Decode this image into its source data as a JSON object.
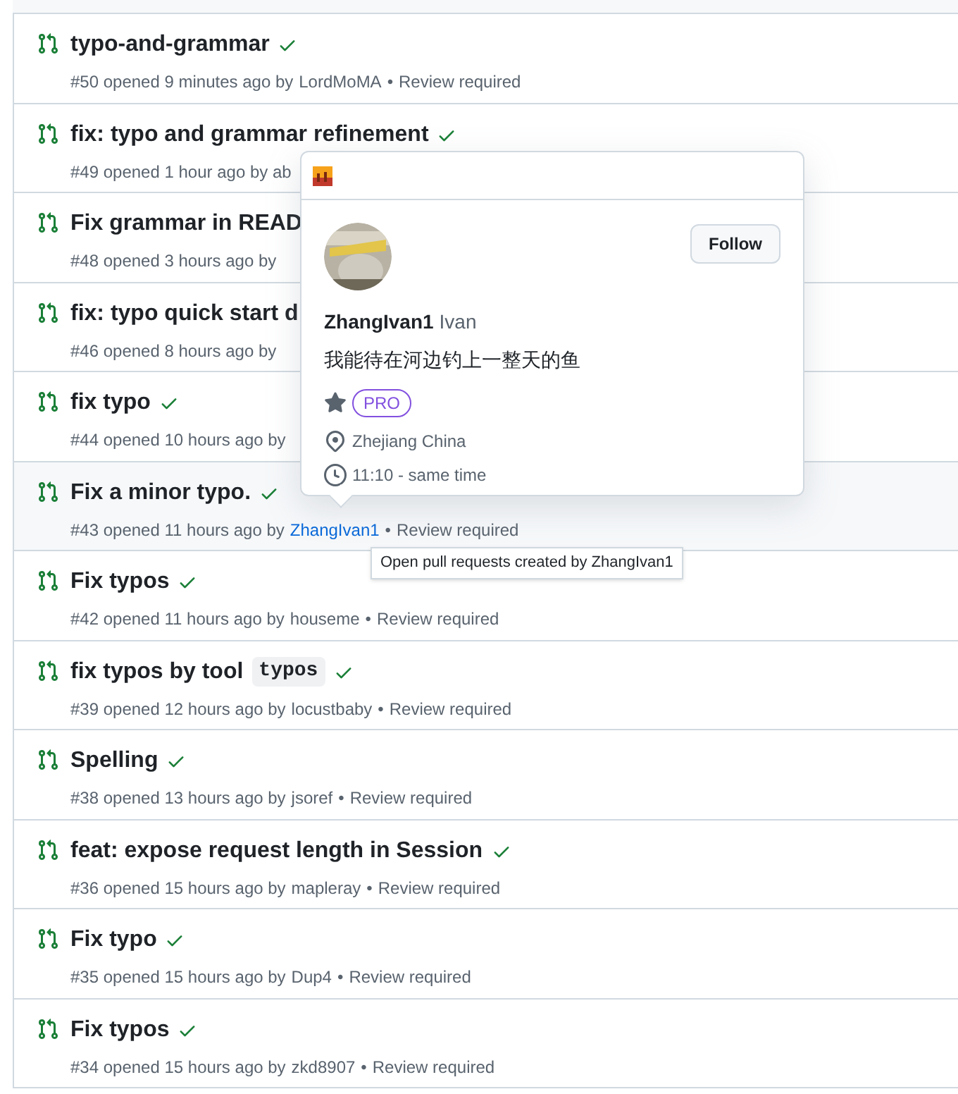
{
  "pull_requests": [
    {
      "title": "typo-and-grammar",
      "checked": true,
      "meta": "#50 opened 9 minutes ago by",
      "author": "LordMoMA",
      "separator": "•",
      "status": "Review required",
      "hovered": false
    },
    {
      "title": "fix: typo and grammar refinement",
      "checked": true,
      "meta": "#49 opened 1 hour ago by ab",
      "hovered": false
    },
    {
      "title": "Fix grammar in READ",
      "meta": "#48 opened 3 hours ago by"
    },
    {
      "title": "fix: typo quick start d",
      "meta": "#46 opened 8 hours ago by"
    },
    {
      "title": "fix typo",
      "checked": true,
      "meta": "#44 opened 10 hours ago by",
      "hovered": false
    },
    {
      "title": "Fix a minor typo.",
      "checked": true,
      "meta": "#43 opened 11 hours ago by",
      "author": "ZhangIvan1",
      "separator": "•",
      "status": "Review required",
      "hovered": true
    },
    {
      "title": "Fix typos",
      "checked": true,
      "meta": "#42 opened 11 hours ago by",
      "author": "houseme",
      "separator": "•",
      "status": "Review required",
      "hovered": false
    },
    {
      "title": "fix typos by tool",
      "code": "typos",
      "checked": true,
      "meta": "#39 opened 12 hours ago by",
      "author": "locustbaby",
      "separator": "•",
      "status": "Review required",
      "hovered": false
    },
    {
      "title": "Spelling",
      "checked": true,
      "meta": "#38 opened 13 hours ago by",
      "author": "jsoref",
      "separator": "•",
      "status": "Review required",
      "hovered": false
    },
    {
      "title": "feat: expose request length in Session",
      "checked": true,
      "meta": "#36 opened 15 hours ago by",
      "author": "mapleray",
      "separator": "•",
      "status": "Review required",
      "hovered": false
    },
    {
      "title": "Fix typo",
      "checked": true,
      "meta": "#35 opened 15 hours ago by",
      "author": "Dup4",
      "separator": "•",
      "status": "Review required",
      "hovered": false
    },
    {
      "title": "Fix typos",
      "checked": true,
      "meta": "#34 opened 15 hours ago by",
      "author": "zkd8907",
      "separator": "•",
      "status": "Review required",
      "hovered": false
    }
  ],
  "hovercard": {
    "follow_button": "Follow",
    "username": "ZhangIvan1",
    "display_name": "Ivan",
    "bio": "我能待在河边钓上一整天的鱼",
    "badge": "PRO",
    "location": "Zhejiang China",
    "local_time": "11:10 - same time"
  },
  "tooltip": "Open pull requests created by ZhangIvan1"
}
